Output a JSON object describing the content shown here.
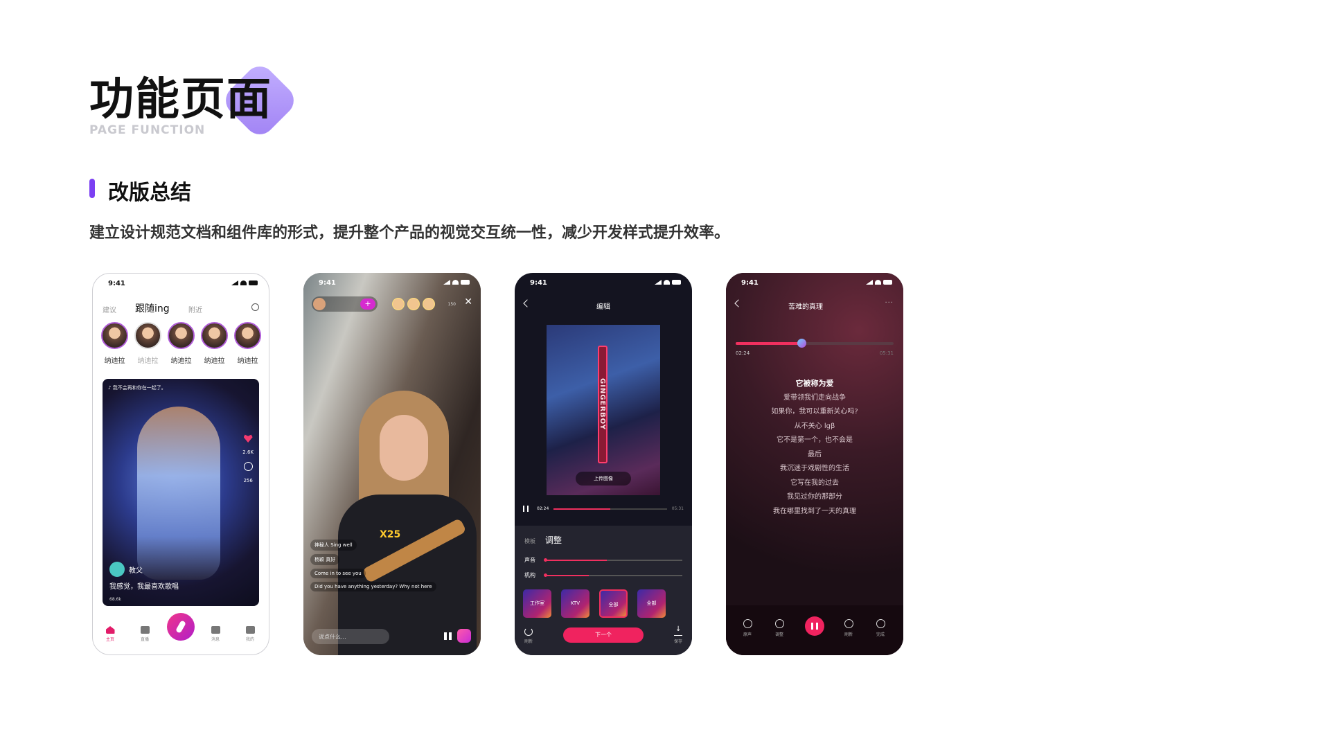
{
  "header": {
    "title": "功能页面",
    "subtitle": "PAGE FUNCTION",
    "section_title": "改版总结",
    "section_desc": "建立设计规范文档和组件库的形式，提升整个产品的视觉交互统一性，减少开发样式提升效率。"
  },
  "status_time": "9:41",
  "phone1": {
    "tabs": [
      "建议",
      "跟随ing",
      "附近"
    ],
    "stories": [
      "纳迪拉",
      "纳迪拉",
      "纳迪拉",
      "纳迪拉",
      "纳迪拉"
    ],
    "song": "♪ 我不会再和你在一起了。",
    "likes": "2.6K",
    "comments": "256",
    "user": "教父",
    "comment": "我感觉，我最喜欢歌唱",
    "plays": "68.6k",
    "nav": [
      "主页",
      "直播",
      "消息",
      "我的"
    ]
  },
  "phone2": {
    "count": "150",
    "gift": "X25",
    "messages": [
      "神秘人 Sing well",
      "杨颖 真好",
      "Come in to see you",
      "Did you have anything yesterday? Why not here"
    ],
    "input_placeholder": "说点什么..."
  },
  "phone3": {
    "title": "编辑",
    "neon_text": "GINGERBOY",
    "upload": "上传图像",
    "time_current": "02:24",
    "time_total": "05:31",
    "tab_template": "模板",
    "tab_adjust": "调整",
    "slider1": "声音",
    "slider2": "机构",
    "slider1_value": 0.45,
    "slider2_value": 0.32,
    "effects": [
      "工作室",
      "KTV",
      "全部",
      "全部"
    ],
    "foot_left": "刷新",
    "next": "下一个",
    "foot_right": "保存"
  },
  "phone4": {
    "title": "苦难的真理",
    "time_current": "02:24",
    "time_total": "05:31",
    "lyrics_current": "它被称为爱",
    "lyrics": [
      "爱带领我们走向战争",
      "如果你，我可以重新关心吗?",
      "从不关心 lgβ",
      "它不是第一个，也不会是",
      "最后",
      "我沉迷于戏剧性的生活",
      "它写在我的过去",
      "我见过你的那部分",
      "我在哪里找到了一天的真理"
    ],
    "controls": [
      "原声",
      "调整",
      "刷新",
      "完成"
    ]
  }
}
